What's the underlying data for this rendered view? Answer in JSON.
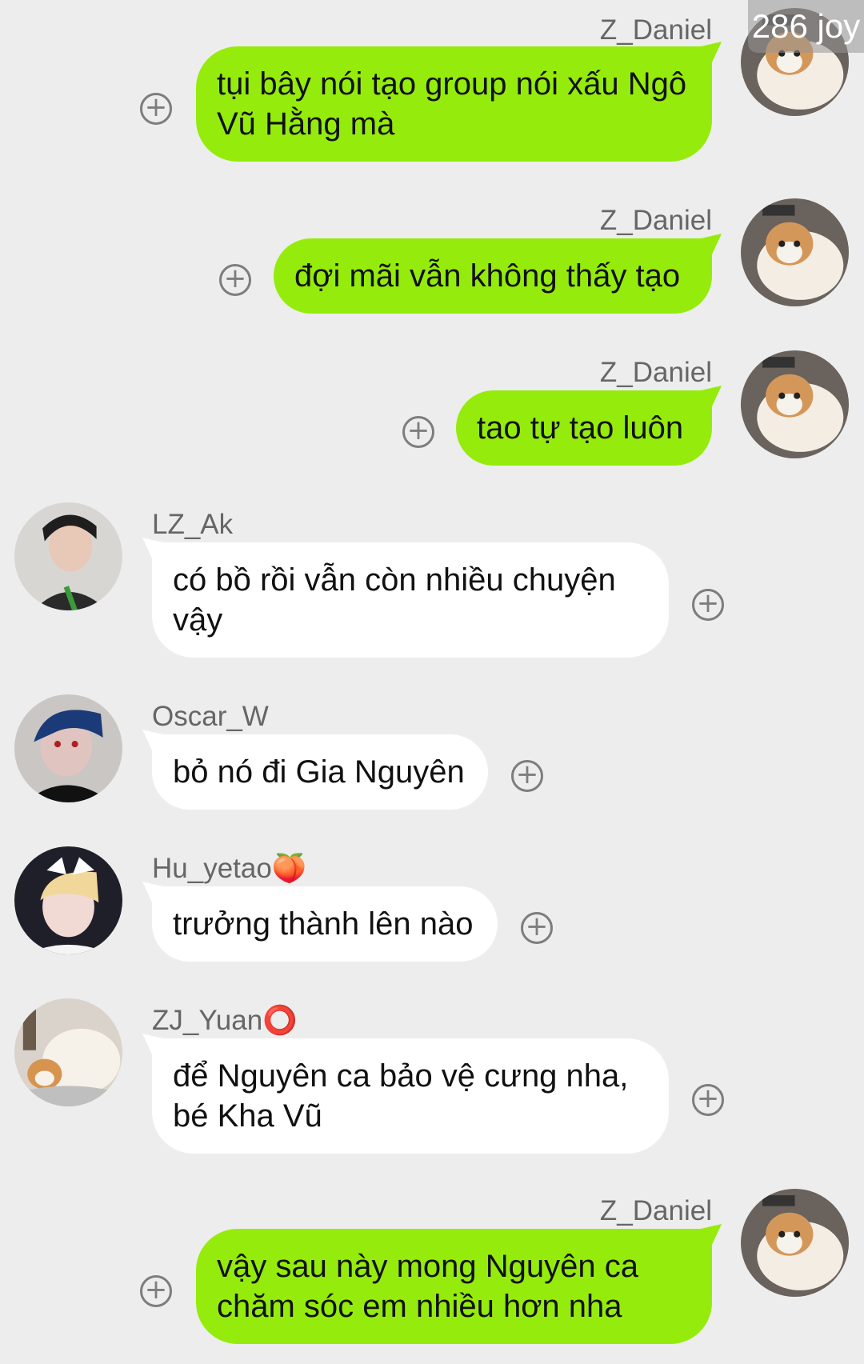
{
  "counter": {
    "text": "286 joy"
  },
  "messages": [
    {
      "sender": "Z_Daniel",
      "text": "tụi bây nói tạo group nói xấu Ngô Vũ Hằng mà",
      "direction": "outgoing",
      "avatar": "cat-avatar"
    },
    {
      "sender": "Z_Daniel",
      "text": "đợi mãi vẫn không thấy tạo",
      "direction": "outgoing",
      "avatar": "cat-avatar"
    },
    {
      "sender": "Z_Daniel",
      "text": "tao tự tạo luôn",
      "direction": "outgoing",
      "avatar": "cat-avatar"
    },
    {
      "sender": "LZ_Ak",
      "text": "có bồ rồi vẫn còn nhiều chuyện vậy",
      "direction": "incoming",
      "avatar": "person-avatar"
    },
    {
      "sender": "Oscar_W",
      "text": "bỏ nó đi Gia Nguyên",
      "direction": "incoming",
      "avatar": "person-avatar"
    },
    {
      "sender": "Hu_yetao🍑",
      "text": "trưởng thành lên nào",
      "direction": "incoming",
      "avatar": "person-avatar"
    },
    {
      "sender": "ZJ_Yuan⭕",
      "text": "để Nguyên ca bảo vệ cưng nha, bé Kha Vũ",
      "direction": "incoming",
      "avatar": "cat-avatar"
    },
    {
      "sender": "Z_Daniel",
      "text": "vậy sau này mong Nguyên ca chăm sóc em nhiều hơn nha",
      "direction": "outgoing",
      "avatar": "cat-avatar"
    }
  ],
  "icons": {
    "add": "plus-circle-icon"
  },
  "colors": {
    "background": "#ededed",
    "outgoing_bubble": "#95ec0c",
    "incoming_bubble": "#ffffff",
    "name_text": "#666666"
  }
}
